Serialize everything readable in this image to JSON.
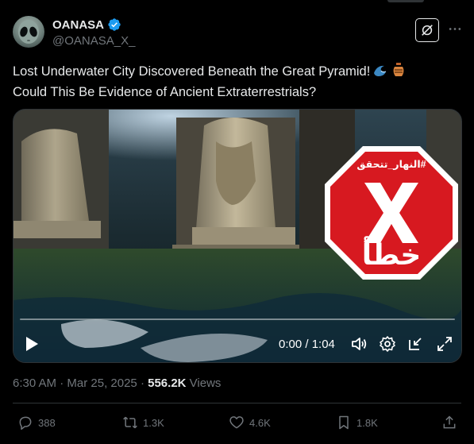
{
  "author": {
    "display_name": "OANASA",
    "handle": "@OANASA_X_",
    "verified": true
  },
  "tweet": {
    "line1": "Lost Underwater City Discovered Beneath the Great Pyramid!",
    "line2": "Could This Be Evidence of Ancient Extraterrestrials?",
    "emojis": [
      "water-wave-emoji",
      "amphora-emoji"
    ]
  },
  "media": {
    "overlay_hashtag": "#النهار_تتحقق",
    "overlay_verdict": "خطأ",
    "overlay_icon": "x-mark-icon",
    "time_display": "0:00 / 1:04",
    "progress_fraction": 0.0,
    "controls": [
      "play-icon",
      "volume-icon",
      "settings-gear-icon",
      "minimize-icon",
      "fullscreen-icon"
    ]
  },
  "meta": {
    "time": "6:30 AM",
    "date": "Mar 25, 2025",
    "separator": "·",
    "views_count": "556.2K",
    "views_label": "Views"
  },
  "actions": {
    "replies": "388",
    "reposts": "1.3K",
    "likes": "4.6K",
    "bookmarks": "1.8K"
  },
  "colors": {
    "background": "#000000",
    "text_primary": "#e7e9ea",
    "text_secondary": "#71767b",
    "verified_blue": "#1d9bf0",
    "stop_red": "#d71920",
    "divider": "#2f3336"
  }
}
